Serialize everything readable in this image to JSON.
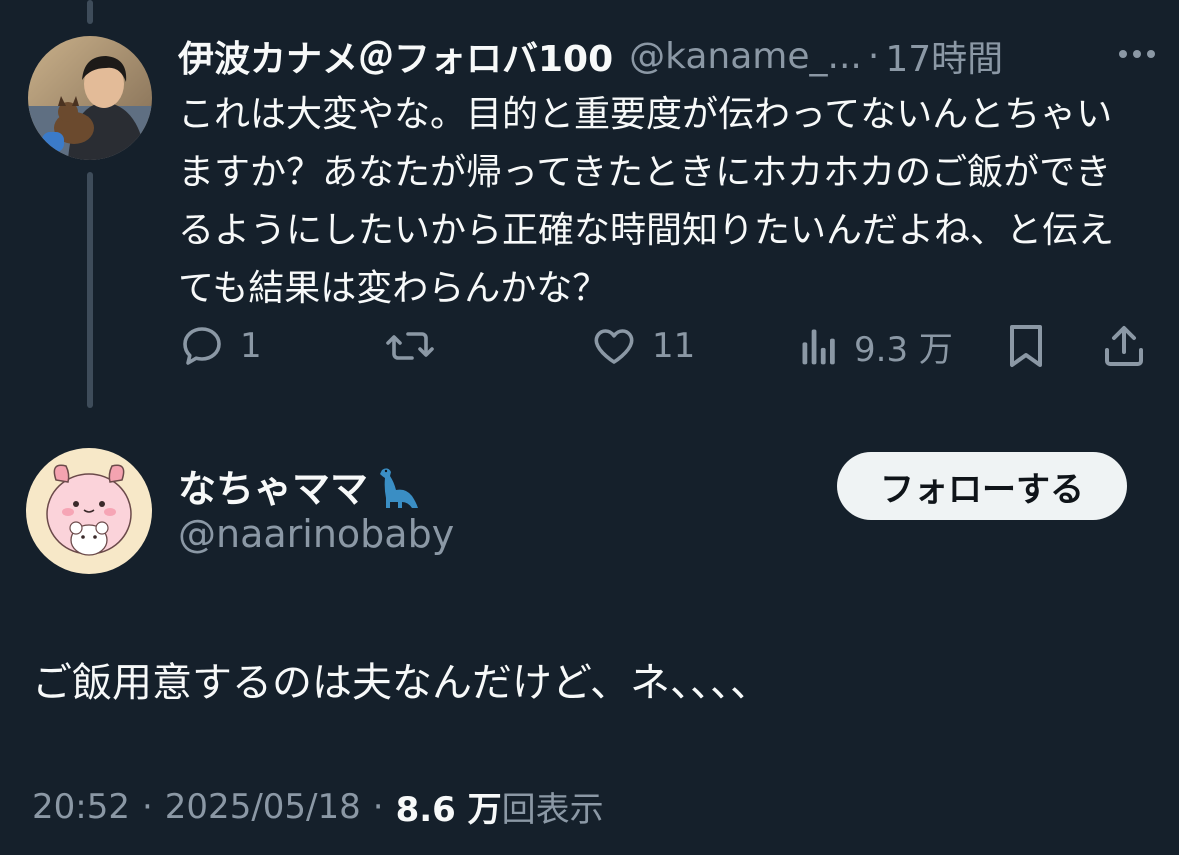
{
  "reply": {
    "name": "伊波カナメ＠フォロバ100",
    "handle": "@kaname_...",
    "separator": "·",
    "time": "17時間",
    "text": "これは大変やな。目的と重要度が伝わってないんとちゃいますか？あなたが帰ってきたときにホカホカのご飯ができるようにしたいから正確な時間知りたいんだよね、と伝えても結果は変わらんかな？",
    "avatar_icon": "person-with-dog-avatar",
    "actions": {
      "reply_count": "1",
      "repost_count": "",
      "like_count": "11",
      "views_count": "9.3 万"
    }
  },
  "main_post": {
    "name": "なちゃママ",
    "name_emoji_icon": "dinosaur-emoji-icon",
    "handle": "@naarinobaby",
    "follow_label": "フォローする",
    "text": "ご飯用意するのは夫なんだけど、ネ、、、、",
    "avatar_icon": "cartoon-character-avatar",
    "time": "20:52",
    "date": "2025/05/18",
    "separator": "·",
    "views_count": "8.6 万",
    "views_label": "回表示"
  },
  "colors": {
    "background": "#15202b",
    "text_primary": "#f7f9f9",
    "text_secondary": "#8b98a5",
    "thread_line": "#3e4c5a",
    "follow_button_bg": "#eff3f4"
  }
}
